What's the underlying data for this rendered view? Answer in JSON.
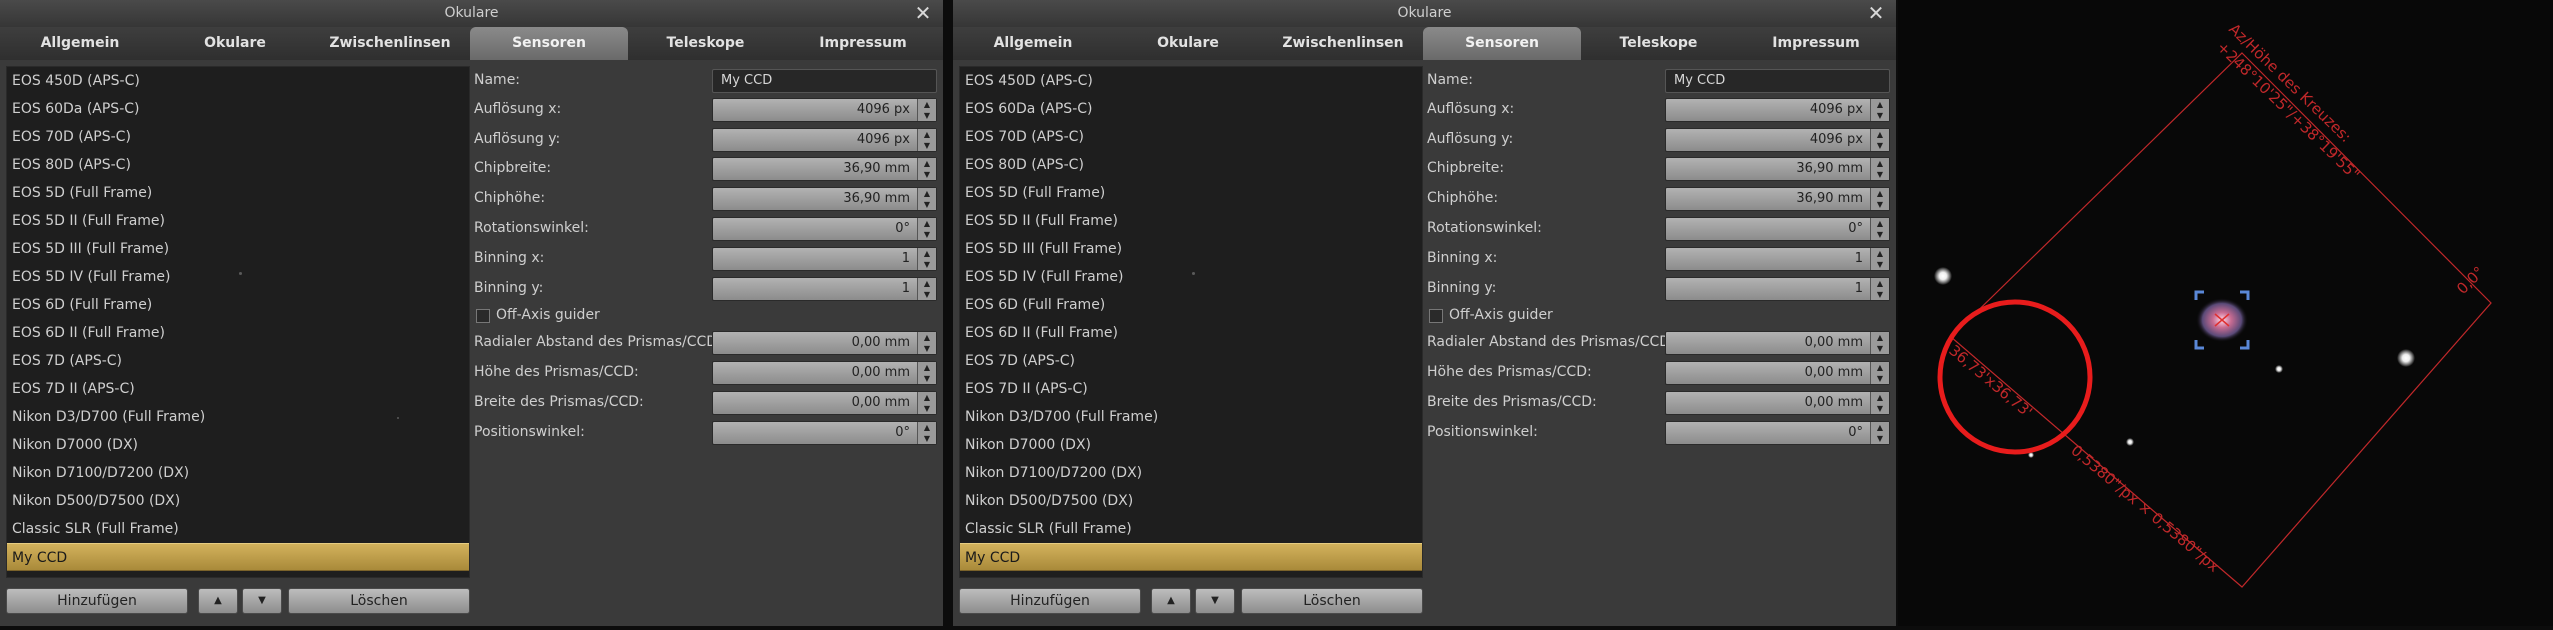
{
  "dialog": {
    "title": "Okulare",
    "close_glyph": "✕",
    "tabs": [
      "Allgemein",
      "Okulare",
      "Zwischenlinsen",
      "Sensoren",
      "Teleskope",
      "Impressum"
    ],
    "active_tab": "Sensoren",
    "sensors": [
      "EOS 450D (APS-C)",
      "EOS 60Da (APS-C)",
      "EOS 70D (APS-C)",
      "EOS 80D (APS-C)",
      "EOS 5D (Full Frame)",
      "EOS 5D II (Full Frame)",
      "EOS 5D III (Full Frame)",
      "EOS 5D IV (Full Frame)",
      "EOS 6D (Full Frame)",
      "EOS 6D II (Full Frame)",
      "EOS 7D (APS-C)",
      "EOS 7D II (APS-C)",
      "Nikon D3/D700 (Full Frame)",
      "Nikon D7000 (DX)",
      "Nikon D7100/D7200 (DX)",
      "Nikon D500/D7500 (DX)",
      "Classic SLR (Full Frame)",
      "My CCD"
    ],
    "selected_sensor": "My CCD",
    "buttons": {
      "add": "Hinzufügen",
      "up": "▲",
      "down": "▼",
      "delete": "Löschen"
    },
    "form": {
      "name": {
        "label": "Name:",
        "value": "My CCD"
      },
      "res_x": {
        "label": "Auflösung x:",
        "value": "4096 px"
      },
      "res_y": {
        "label": "Auflösung y:",
        "value": "4096 px"
      },
      "chip_width": {
        "label": "Chipbreite:",
        "value": "36,90 mm"
      },
      "chip_height": {
        "label": "Chiphöhe:",
        "value": "36,90 mm"
      },
      "rotation": {
        "label": "Rotationswinkel:",
        "value": "0°"
      },
      "binning_x": {
        "label": "Binning x:",
        "value": "1"
      },
      "binning_y": {
        "label": "Binning y:",
        "value": "1"
      },
      "oag": {
        "label": "Off-Axis guider",
        "checked": false
      },
      "prism_distance": {
        "label": "Radialer Abstand des Prismas/CCD:",
        "value": "0,00 mm"
      },
      "prism_height": {
        "label": "Höhe des Prismas/CCD:",
        "value": "0,00 mm"
      },
      "prism_width": {
        "label": "Breite des Prismas/CCD:",
        "value": "0,00 mm"
      },
      "position_angle": {
        "label": "Positionswinkel:",
        "value": "0°"
      }
    }
  },
  "sky": {
    "frame_color": "#c0282a",
    "highlight_circle_color": "#e81c1c",
    "label_altaz_1": "Az/Höhe des Kreuzes:",
    "label_altaz_2": "+248°10'25\"/+38°19'55\"",
    "label_rotation": "0,0°",
    "label_fov": "36,73'x36,73'",
    "label_scale": "0,5380\"/px × 0,5380\"/px"
  }
}
